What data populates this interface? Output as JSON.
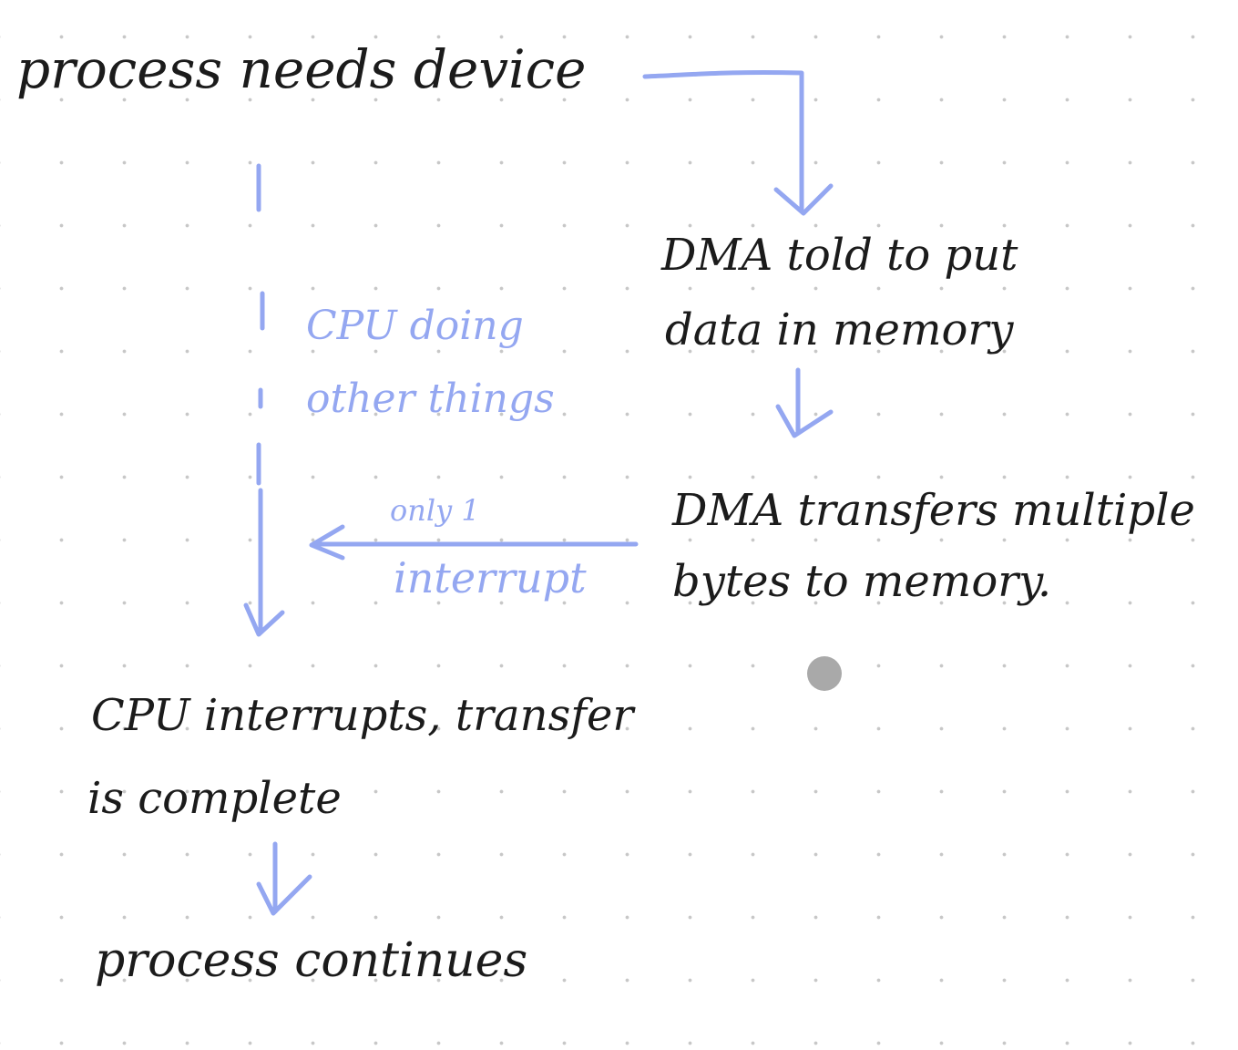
{
  "diagram": {
    "nodes": {
      "process_needs_device": "process needs device",
      "dma_told_line1": "DMA told to put",
      "dma_told_line2": "data in memory",
      "cpu_doing_line1": "CPU doing",
      "cpu_doing_line2": "other things",
      "dma_transfers_line1": "DMA transfers multiple",
      "dma_transfers_line2": "bytes to memory.",
      "cpu_interrupts_line1": "CPU interrupts, transfer",
      "cpu_interrupts_line2": "is complete",
      "process_continues": "process continues"
    },
    "edge_labels": {
      "only_one": "only 1",
      "interrupt": "interrupt"
    }
  },
  "colors": {
    "ink": "#1b1b1b",
    "accent": "#94a7f1",
    "grid_dot": "#c7c7c7",
    "pointer": "#a9a9a9"
  }
}
